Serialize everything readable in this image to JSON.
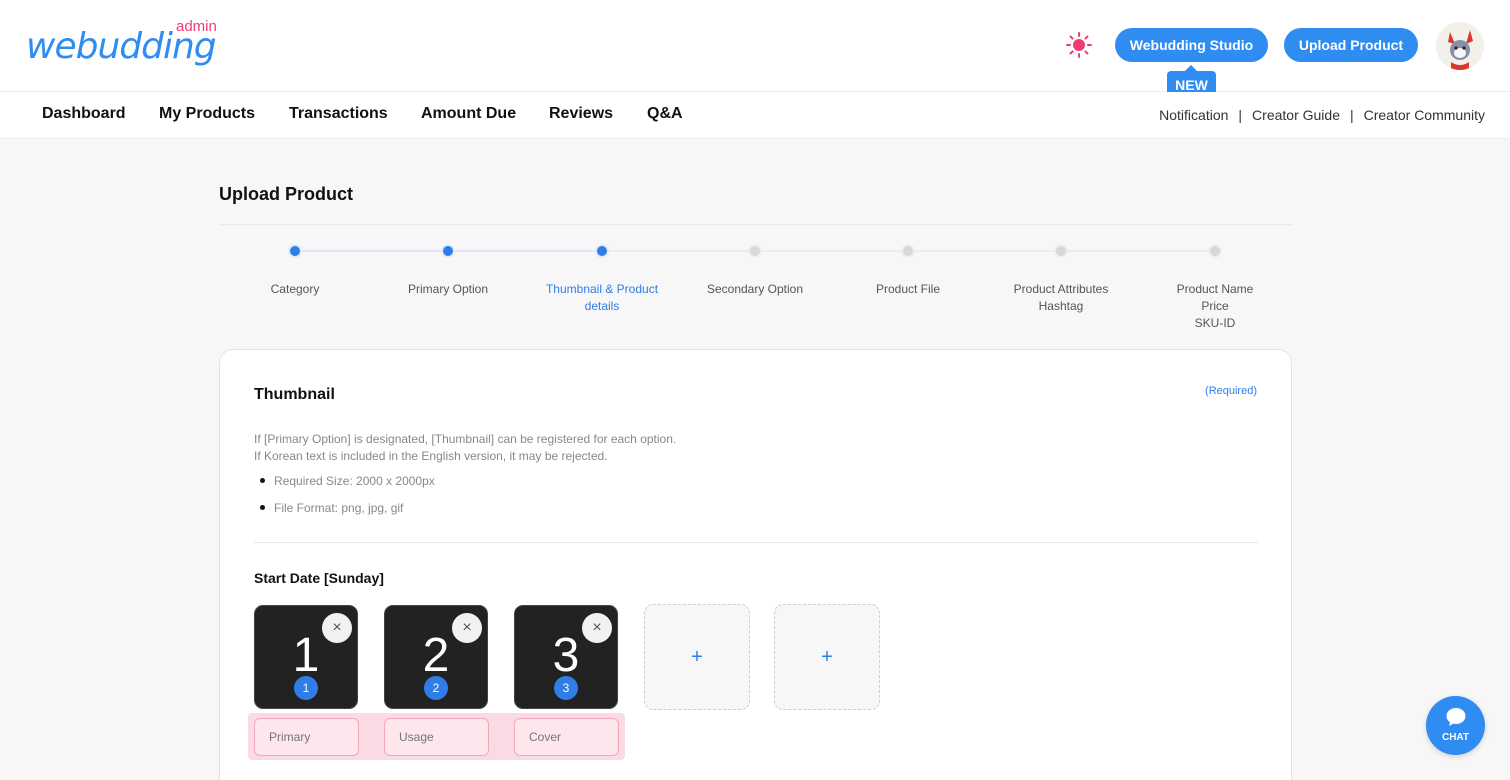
{
  "brand": {
    "logo_text": "webudding",
    "logo_suffix": "admin"
  },
  "header": {
    "theme_icon": "sun-icon",
    "studio_label": "Webudding Studio",
    "new_badge": "NEW",
    "upload_label": "Upload Product",
    "avatar_icon": "avatar-character"
  },
  "nav": {
    "items": [
      "Dashboard",
      "My Products",
      "Transactions",
      "Amount Due",
      "Reviews",
      "Q&A"
    ],
    "right": [
      "Notification",
      "Creator Guide",
      "Creator Community"
    ],
    "separator": "|"
  },
  "page": {
    "title": "Upload Product"
  },
  "steps": [
    {
      "label": "Category",
      "state": "done"
    },
    {
      "label": "Primary Option",
      "state": "done"
    },
    {
      "label": "Thumbnail & Product\ndetails",
      "state": "current"
    },
    {
      "label": "Secondary Option",
      "state": "pending"
    },
    {
      "label": "Product File",
      "state": "pending"
    },
    {
      "label": "Product Attributes\nHashtag",
      "state": "pending"
    },
    {
      "label": "Product Name\nPrice\nSKU-ID",
      "state": "pending"
    }
  ],
  "thumbnail": {
    "title": "Thumbnail",
    "required": "(Required)",
    "desc_line1": "If [Primary Option] is designated, [Thumbnail] can be registered for each option.",
    "desc_line2": "If Korean text is included in the English version, it may be rejected.",
    "bullets": [
      "Required Size: 2000 x 2000px",
      "File Format: png, jpg, gif"
    ],
    "section_title": "Start Date [Sunday]",
    "images": [
      {
        "number": "1",
        "badge": "1",
        "role_placeholder": "Primary"
      },
      {
        "number": "2",
        "badge": "2",
        "role_placeholder": "Usage"
      },
      {
        "number": "3",
        "badge": "3",
        "role_placeholder": "Cover"
      }
    ],
    "close_glyph": "×",
    "add_glyph": "+"
  },
  "chat": {
    "label": "CHAT",
    "icon": "chat-bubble-icon"
  },
  "colors": {
    "accent": "#2f8cf0",
    "brand_pink": "#ef3d72",
    "error_pink": "#fadbe3"
  }
}
